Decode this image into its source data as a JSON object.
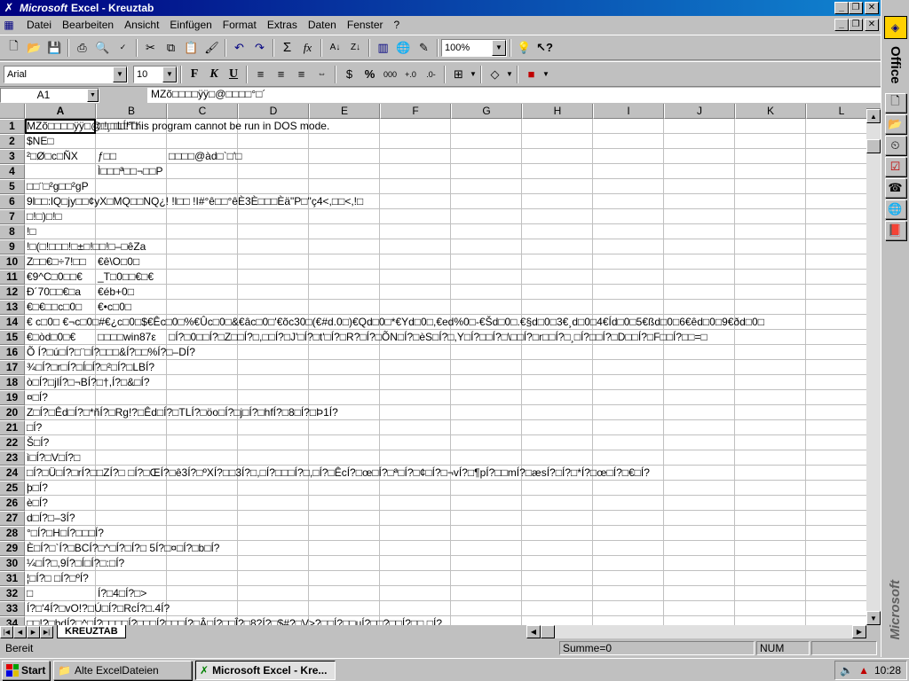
{
  "window": {
    "brand": "Microsoft",
    "title": "Excel - Kreuztab"
  },
  "menu": {
    "items": [
      {
        "label": "Datei",
        "hotkey": "D"
      },
      {
        "label": "Bearbeiten",
        "hotkey": "B"
      },
      {
        "label": "Ansicht",
        "hotkey": "A"
      },
      {
        "label": "Einfügen",
        "hotkey": "E"
      },
      {
        "label": "Format",
        "hotkey": "m"
      },
      {
        "label": "Extras",
        "hotkey": "x"
      },
      {
        "label": "Daten",
        "hotkey": "D"
      },
      {
        "label": "Fenster",
        "hotkey": "F"
      },
      {
        "label": "?",
        "hotkey": "?"
      }
    ]
  },
  "toolbar": {
    "zoom": "100%",
    "font_name": "Arial",
    "font_size": "10",
    "sum_symbol": "Σ",
    "fx_symbol": "fx",
    "bold": "F",
    "italic": "K",
    "underline": "U",
    "percent": "%",
    "thousands": "000"
  },
  "formula": {
    "cell_ref": "A1",
    "content": "MZõ□□□□ÿÿ□@□□□□°□´"
  },
  "grid": {
    "columns": [
      "A",
      "B",
      "C",
      "D",
      "E",
      "F",
      "G",
      "H",
      "I",
      "J",
      "K",
      "L"
    ],
    "rows": [
      {
        "num": "1",
        "a": "MZõ□□□□ÿÿ□@□□□□°□´",
        "b": "□!¸□LÍ!This program cannot be run in DOS mode.",
        "c": ""
      },
      {
        "num": "2",
        "a": "$NE□",
        "b": "",
        "c": ""
      },
      {
        "num": "3",
        "a": "²□Ø□c□ÑX",
        "b": "ƒ□□",
        "c": "□□□□@àd□`□'□"
      },
      {
        "num": "4",
        "a": "",
        "b": "Ì□□□ª□□¬□□P",
        "c": ""
      },
      {
        "num": "5",
        "a": "□□¨□²g□□²gP",
        "b": "",
        "c": ""
      },
      {
        "num": "6",
        "a": "9l□□:lQ□jy□□¢yX□MQ□□NQ¿! !l□□ !I#°ê□□°êÈ3È□□□Èä\"P□\"ç4<,□□<,!□",
        "b": "",
        "c": ""
      },
      {
        "num": "7",
        "a": "□!□)□!□",
        "b": "",
        "c": ""
      },
      {
        "num": "8",
        "a": "!□",
        "b": "",
        "c": ""
      },
      {
        "num": "9",
        "a": "!□(□!□□□!□±□!□□!□–□êZa",
        "b": "",
        "c": ""
      },
      {
        "num": "10",
        "a": "Z□□€□÷7!□□",
        "b": "€ê\\O□0□",
        "c": ""
      },
      {
        "num": "11",
        "a": "€9^C□0□□€",
        "b": "_T□0□□€□€",
        "c": ""
      },
      {
        "num": "12",
        "a": "Ð´70□□€□a",
        "b": "€éb+0□",
        "c": ""
      },
      {
        "num": "13",
        "a": "€□€□□c□0□",
        "b": "€•c□0□",
        "c": ""
      },
      {
        "num": "14",
        "a": "€ c□0□ €¬c□0□#€¿c□0□$€Êc□0□%€Ûc□0□&€âc□0□'€õc30□(€#d.0□)€Qd□0□*€Yd□0□,€ed%0□-€Šd□0□.€§d□0□3€¸d□0□4€Íd□0□5€ßd□0□6€êd□0□9€ðd□0□",
        "b": "",
        "c": ""
      },
      {
        "num": "15",
        "a": "€□òd□0□€",
        "b": "□□□□win87ε",
        "c": "□Í?□0□□Í?□Z□□Í?□,□□Í?□J'□Í?□t'□Í?□R?□Í?□ÕN□Í?□èS□Í?□,Y□Í?□□Í?□\\□□Í?□r□□Í?□¸□Í?□□Í?□D□□Í?□F□□Í?□□=□"
      },
      {
        "num": "16",
        "a": "Õ Í?□ú□Í?□¨□Í?□□□&Í?□□%Í?□–DÍ?",
        "b": "",
        "c": ""
      },
      {
        "num": "17",
        "a": "¾□Í?□r□Í?□Í□Í?□²□Í?□LBÍ?",
        "b": "",
        "c": ""
      },
      {
        "num": "18",
        "a": "ò□Í?□jlÍ?□¬BÍ?□†,Í?□&□Í?",
        "b": "",
        "c": ""
      },
      {
        "num": "19",
        "a": "¤□Í?",
        "b": "",
        "c": ""
      },
      {
        "num": "20",
        "a": "Z□Í?□Êd□Í?□*ñÍ?□Rg!?□Êd□Í?□TLÍ?□öo□Í?□j□Í?□hfÍ?□8□Í?□Þ1Í?",
        "b": "",
        "c": ""
      },
      {
        "num": "21",
        "a": "□Í?",
        "b": "",
        "c": ""
      },
      {
        "num": "22",
        "a": "Š□Í?",
        "b": "",
        "c": ""
      },
      {
        "num": "23",
        "a": "ì□Í?□V□Í?□",
        "b": "",
        "c": ""
      },
      {
        "num": "24",
        "a": "□Í?□Ü□Í?□rÍ?□□ZÍ?□ □Í?□ŒÍ?□ê3Í?□ºXÍ?□□3Í?□,□Í?□□□Í?□,□Í?□ÊcÍ?□œ□Í?□ª□Í?□¢□Í?□¬vÍ?□¶pÍ?□□mÍ?□æsÍ?□Í?□*Í?□œ□Í?□€□Í?",
        "b": "",
        "c": ""
      },
      {
        "num": "25",
        "a": "þ□Í?",
        "b": "",
        "c": ""
      },
      {
        "num": "26",
        "a": "è□Í?",
        "b": "",
        "c": ""
      },
      {
        "num": "27",
        "a": "d□Í?□–3Í?",
        "b": "",
        "c": ""
      },
      {
        "num": "28",
        "a": "°□Í?□H□Í?□□□Í?",
        "b": "",
        "c": ""
      },
      {
        "num": "29",
        "a": "È□Í?□`Í?□BCÍ?□^□Í?□Í?□ 5Í?□¤□Í?□b□Í?",
        "b": "",
        "c": ""
      },
      {
        "num": "30",
        "a": "¼□Í?□,9Í?□Í□Í?□:□Í?",
        "b": "",
        "c": ""
      },
      {
        "num": "31",
        "a": "¦□Í?□ □Í?□ºÍ?",
        "b": "",
        "c": ""
      },
      {
        "num": "32",
        "a": "□",
        "b": "Í?□4□Í?□>",
        "c": ""
      },
      {
        "num": "33",
        "a": "Í?□'4Í?□vO!?□Ú□Í?□RcÍ?□.4Í?",
        "b": "",
        "c": ""
      },
      {
        "num": "34",
        "a": "□□!?□bdÍ?□^□Í?□□□□Í?□□□Í?□□□Í?□Â□Í?□□Î?□8?Í?□$#?□V>?□□Í?□□uÍ?□□?□□Í?□□.□Í?",
        "b": "",
        "c": ""
      }
    ]
  },
  "sheet_tab": "KREUZTAB",
  "status": {
    "text": "Bereit",
    "sum": "Summe=0",
    "num": "NUM"
  },
  "officebar": {
    "label": "Office",
    "brand": "Microsoft"
  },
  "taskbar": {
    "start": "Start",
    "tasks": [
      {
        "label": "Alte ExcelDateien",
        "active": false
      },
      {
        "label": "Microsoft Excel - Kre...",
        "active": true
      }
    ],
    "clock": "10:28"
  },
  "colors": {
    "title_bar": "#000080",
    "face": "#c0c0c0",
    "excel_green": "#008000"
  }
}
